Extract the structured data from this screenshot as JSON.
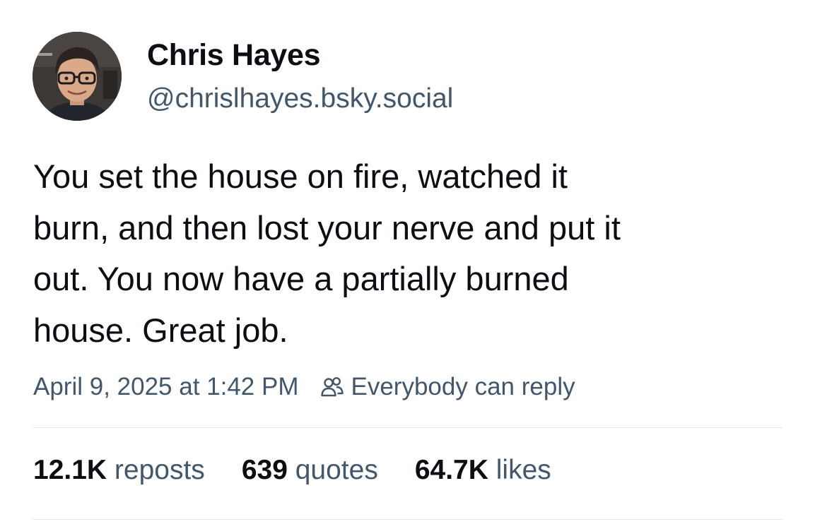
{
  "author": {
    "name": "Chris Hayes",
    "handle": "@chrislhayes.bsky.social",
    "avatar_icon": "profile-photo"
  },
  "post": {
    "lines": [
      "You set the house on fire, watched it",
      "burn, and then lost your nerve and put it",
      "out. You now have a partially burned",
      "house. Great job."
    ],
    "timestamp": "April 9, 2025 at 1:42 PM",
    "reply_setting": "Everybody can reply",
    "reply_icon": "people-icon"
  },
  "stats": {
    "reposts": {
      "count": "12.1K",
      "label": "reposts"
    },
    "quotes": {
      "count": "639",
      "label": "quotes"
    },
    "likes": {
      "count": "64.7K",
      "label": "likes"
    }
  },
  "colors": {
    "text": "#0b0f14",
    "secondary": "#42576c",
    "divider": "#e3e8ed"
  }
}
